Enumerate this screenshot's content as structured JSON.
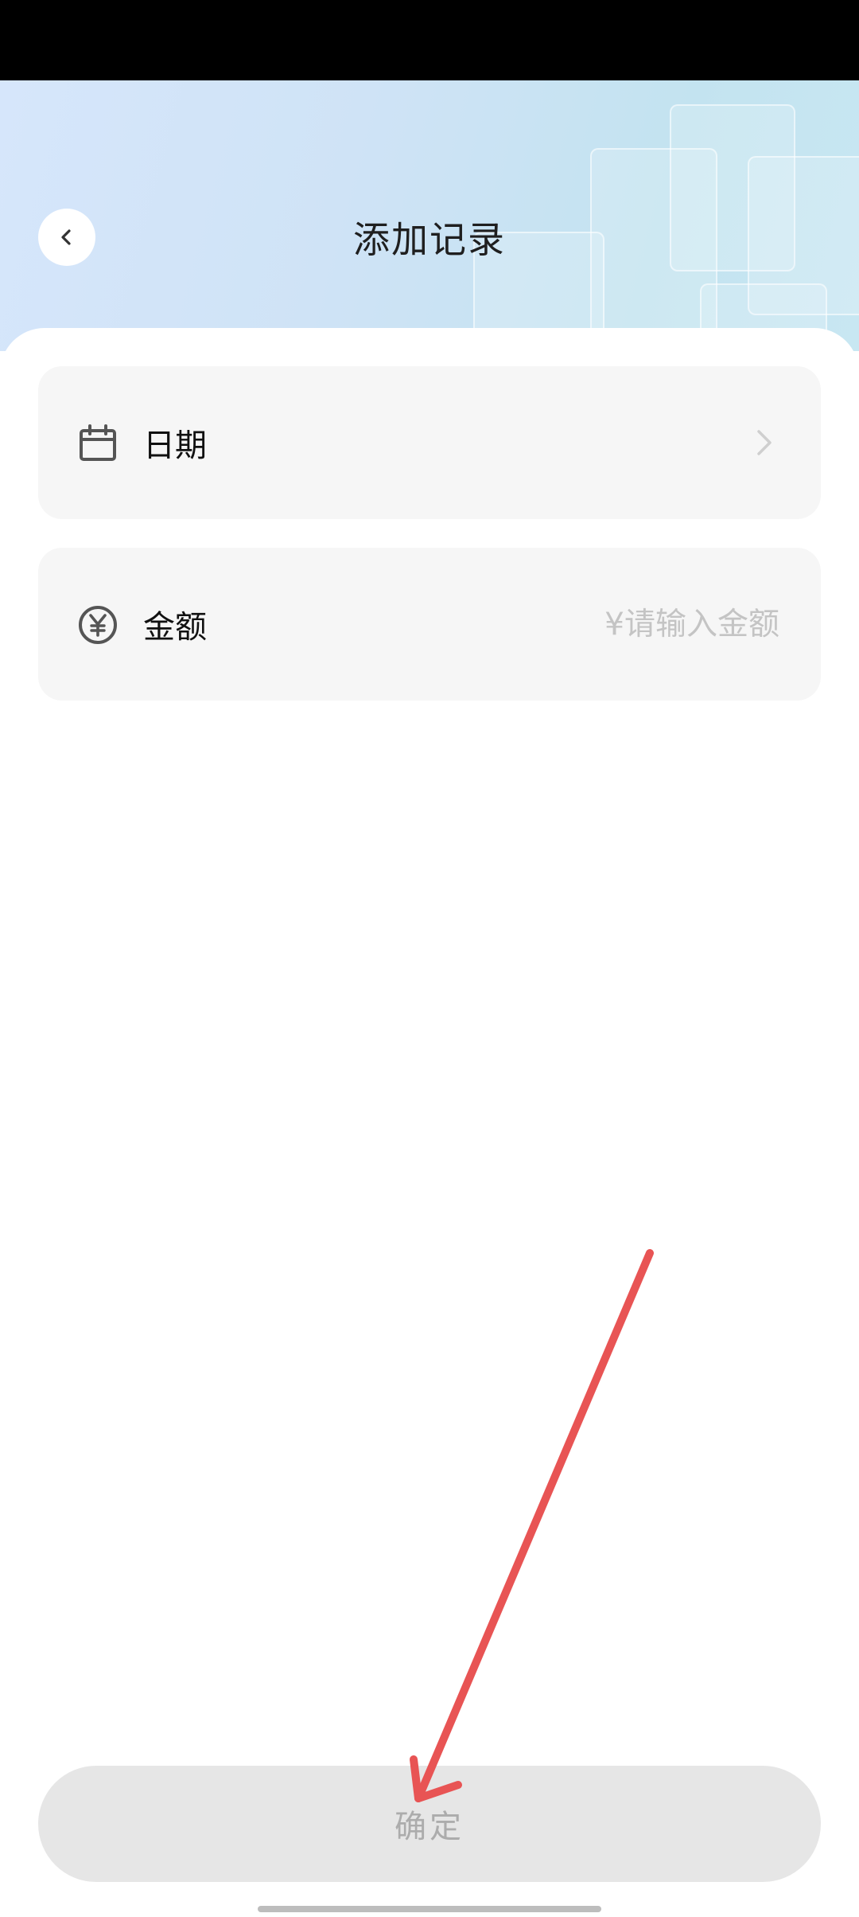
{
  "header": {
    "title": "添加记录",
    "back_icon": "chevron-left-icon"
  },
  "form": {
    "date_field": {
      "label": "日期",
      "icon": "calendar-icon",
      "trailing_icon": "chevron-right-icon"
    },
    "amount_field": {
      "label": "金额",
      "icon": "yen-circle-icon",
      "value": "",
      "placeholder": "¥请输入金额"
    }
  },
  "footer": {
    "confirm_label": "确定",
    "confirm_enabled": false
  },
  "colors": {
    "header_gradient_start": "#d6e6fb",
    "header_gradient_end": "#c3e3f0",
    "card_background": "#f6f6f6",
    "button_disabled_bg": "#e6e6e6",
    "button_disabled_text": "#acacac",
    "annotation_arrow": "#e85454"
  }
}
